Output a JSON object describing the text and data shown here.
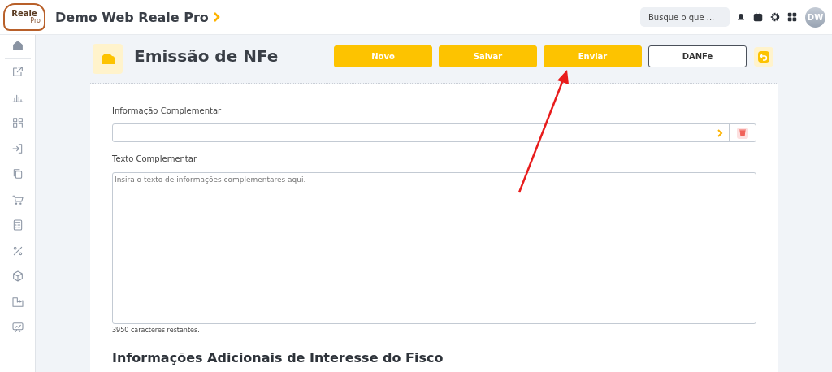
{
  "app": {
    "title": "Demo Web Reale Pro",
    "logo_text": "Reale",
    "logo_subtext": "Pro"
  },
  "search": {
    "placeholder": "Busque o que ..."
  },
  "user": {
    "initials": "DW"
  },
  "page": {
    "title": "Emissão de NFe"
  },
  "actions": [
    {
      "label": "Novo",
      "kind": "primary"
    },
    {
      "label": "Salvar",
      "kind": "primary"
    },
    {
      "label": "Enviar",
      "kind": "primary"
    },
    {
      "label": "DANFe",
      "kind": "outline"
    }
  ],
  "info_field": {
    "label": "Informação Complementar"
  },
  "text_field": {
    "label": "Texto Complementar",
    "placeholder": "Insira o texto de informações complementares aqui.",
    "counter": "3950 caracteres restantes."
  },
  "next_section": {
    "title": "Informações Adicionais de Interesse do Fisco"
  }
}
